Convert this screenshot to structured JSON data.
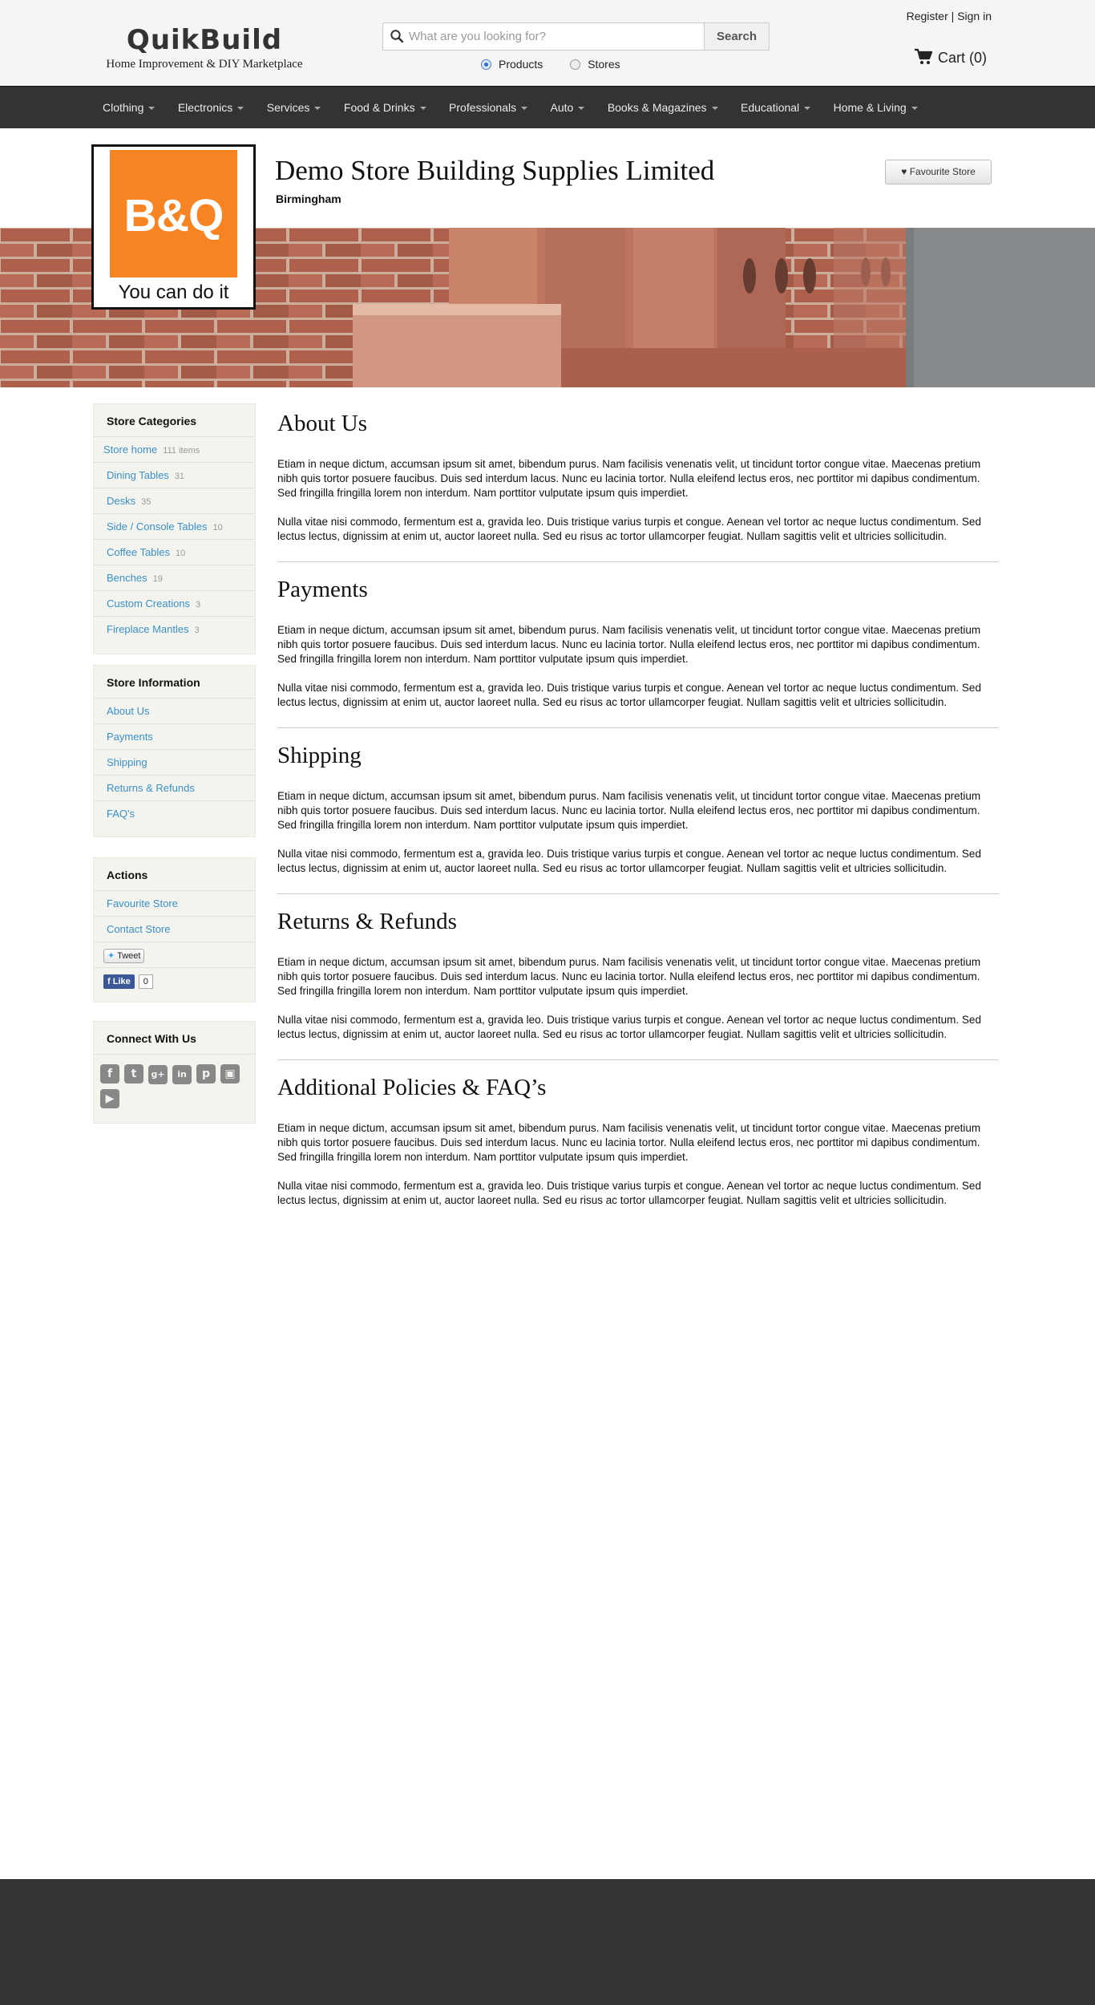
{
  "site": {
    "name": "QuikBuild",
    "tagline": "Home Improvement & DIY Marketplace"
  },
  "search": {
    "placeholder": "What are you looking for?",
    "button_label": "Search",
    "scope_options": [
      "Products",
      "Stores"
    ],
    "selected_scope": "Products"
  },
  "account": {
    "register_label": "Register",
    "separator": "|",
    "signin_label": "Sign in",
    "cart_label": "Cart (0)"
  },
  "nav": {
    "items": [
      "Clothing",
      "Electronics",
      "Services",
      "Food & Drinks",
      "Professionals",
      "Auto",
      "Books & Magazines",
      "Educational",
      "Home & Living"
    ]
  },
  "store": {
    "name": "Demo Store Building Supplies Limited",
    "city": "Birmingham",
    "favourite_button": "Favourite Store",
    "logo_text": "B&Q",
    "logo_slogan": "You can do it",
    "logo_color": "#f78422"
  },
  "sidebar": {
    "categories": {
      "title": "Store Categories",
      "items": [
        {
          "label": "Store home",
          "count": "111 items"
        },
        {
          "label": "Dining Tables",
          "count": "31"
        },
        {
          "label": "Desks",
          "count": "35"
        },
        {
          "label": "Side / Console Tables",
          "count": "10"
        },
        {
          "label": "Coffee Tables",
          "count": "10"
        },
        {
          "label": "Benches",
          "count": "19"
        },
        {
          "label": "Custom Creations",
          "count": "3"
        },
        {
          "label": "Fireplace Mantles",
          "count": "3"
        }
      ]
    },
    "information": {
      "title": "Store Information",
      "items": [
        "About Us",
        "Payments",
        "Shipping",
        "Returns & Refunds",
        "FAQ's"
      ]
    },
    "actions": {
      "title": "Actions",
      "items": [
        "Favourite Store",
        "Contact Store"
      ],
      "tweet_label": "Tweet",
      "like_label": "Like",
      "like_count": "0"
    },
    "connect": {
      "title": "Connect With Us",
      "icons": [
        "facebook-icon",
        "twitter-icon",
        "google-plus-icon",
        "linkedin-icon",
        "pinterest-icon",
        "instagram-icon",
        "youtube-icon"
      ]
    }
  },
  "content": {
    "sections": [
      {
        "title": "About Us",
        "paragraphs": [
          "Etiam in neque dictum, accumsan ipsum sit amet, bibendum purus. Nam facilisis venenatis velit, ut tincidunt tortor congue vitae. Maecenas pretium nibh quis tortor posuere faucibus. Duis sed interdum lacus. Nunc eu lacinia tortor. Nulla eleifend lectus eros, nec porttitor mi dapibus condimentum. Sed fringilla fringilla lorem non interdum. Nam porttitor vulputate ipsum quis imperdiet.",
          "Nulla vitae nisi commodo, fermentum est a, gravida leo. Duis tristique varius turpis et congue. Aenean vel tortor ac neque luctus condimentum. Sed lectus lectus, dignissim at enim ut, auctor laoreet nulla. Sed eu risus ac tortor ullamcorper feugiat. Nullam sagittis velit et ultricies sollicitudin."
        ]
      },
      {
        "title": "Payments",
        "paragraphs": [
          "Etiam in neque dictum, accumsan ipsum sit amet, bibendum purus. Nam facilisis venenatis velit, ut tincidunt tortor congue vitae. Maecenas pretium nibh quis tortor posuere faucibus. Duis sed interdum lacus. Nunc eu lacinia tortor. Nulla eleifend lectus eros, nec porttitor mi dapibus condimentum. Sed fringilla fringilla lorem non interdum. Nam porttitor vulputate ipsum quis imperdiet.",
          "Nulla vitae nisi commodo, fermentum est a, gravida leo. Duis tristique varius turpis et congue. Aenean vel tortor ac neque luctus condimentum. Sed lectus lectus, dignissim at enim ut, auctor laoreet nulla. Sed eu risus ac tortor ullamcorper feugiat. Nullam sagittis velit et ultricies sollicitudin."
        ]
      },
      {
        "title": "Shipping",
        "paragraphs": [
          "Etiam in neque dictum, accumsan ipsum sit amet, bibendum purus. Nam facilisis venenatis velit, ut tincidunt tortor congue vitae. Maecenas pretium nibh quis tortor posuere faucibus. Duis sed interdum lacus. Nunc eu lacinia tortor. Nulla eleifend lectus eros, nec porttitor mi dapibus condimentum. Sed fringilla fringilla lorem non interdum. Nam porttitor vulputate ipsum quis imperdiet.",
          "Nulla vitae nisi commodo, fermentum est a, gravida leo. Duis tristique varius turpis et congue. Aenean vel tortor ac neque luctus condimentum. Sed lectus lectus, dignissim at enim ut, auctor laoreet nulla. Sed eu risus ac tortor ullamcorper feugiat. Nullam sagittis velit et ultricies sollicitudin."
        ]
      },
      {
        "title": "Returns & Refunds",
        "paragraphs": [
          "Etiam in neque dictum, accumsan ipsum sit amet, bibendum purus. Nam facilisis venenatis velit, ut tincidunt tortor congue vitae. Maecenas pretium nibh quis tortor posuere faucibus. Duis sed interdum lacus. Nunc eu lacinia tortor. Nulla eleifend lectus eros, nec porttitor mi dapibus condimentum. Sed fringilla fringilla lorem non interdum. Nam porttitor vulputate ipsum quis imperdiet.",
          "Nulla vitae nisi commodo, fermentum est a, gravida leo. Duis tristique varius turpis et congue. Aenean vel tortor ac neque luctus condimentum. Sed lectus lectus, dignissim at enim ut, auctor laoreet nulla. Sed eu risus ac tortor ullamcorper feugiat. Nullam sagittis velit et ultricies sollicitudin."
        ]
      },
      {
        "title": "Additional Policies & FAQ’s",
        "paragraphs": [
          "Etiam in neque dictum, accumsan ipsum sit amet, bibendum purus. Nam facilisis venenatis velit, ut tincidunt tortor congue vitae. Maecenas pretium nibh quis tortor posuere faucibus. Duis sed interdum lacus. Nunc eu lacinia tortor. Nulla eleifend lectus eros, nec porttitor mi dapibus condimentum. Sed fringilla fringilla lorem non interdum. Nam porttitor vulputate ipsum quis imperdiet.",
          "Nulla vitae nisi commodo, fermentum est a, gravida leo. Duis tristique varius turpis et congue. Aenean vel tortor ac neque luctus condimentum. Sed lectus lectus, dignissim at enim ut, auctor laoreet nulla. Sed eu risus ac tortor ullamcorper feugiat. Nullam sagittis velit et ultricies sollicitudin."
        ]
      }
    ]
  }
}
